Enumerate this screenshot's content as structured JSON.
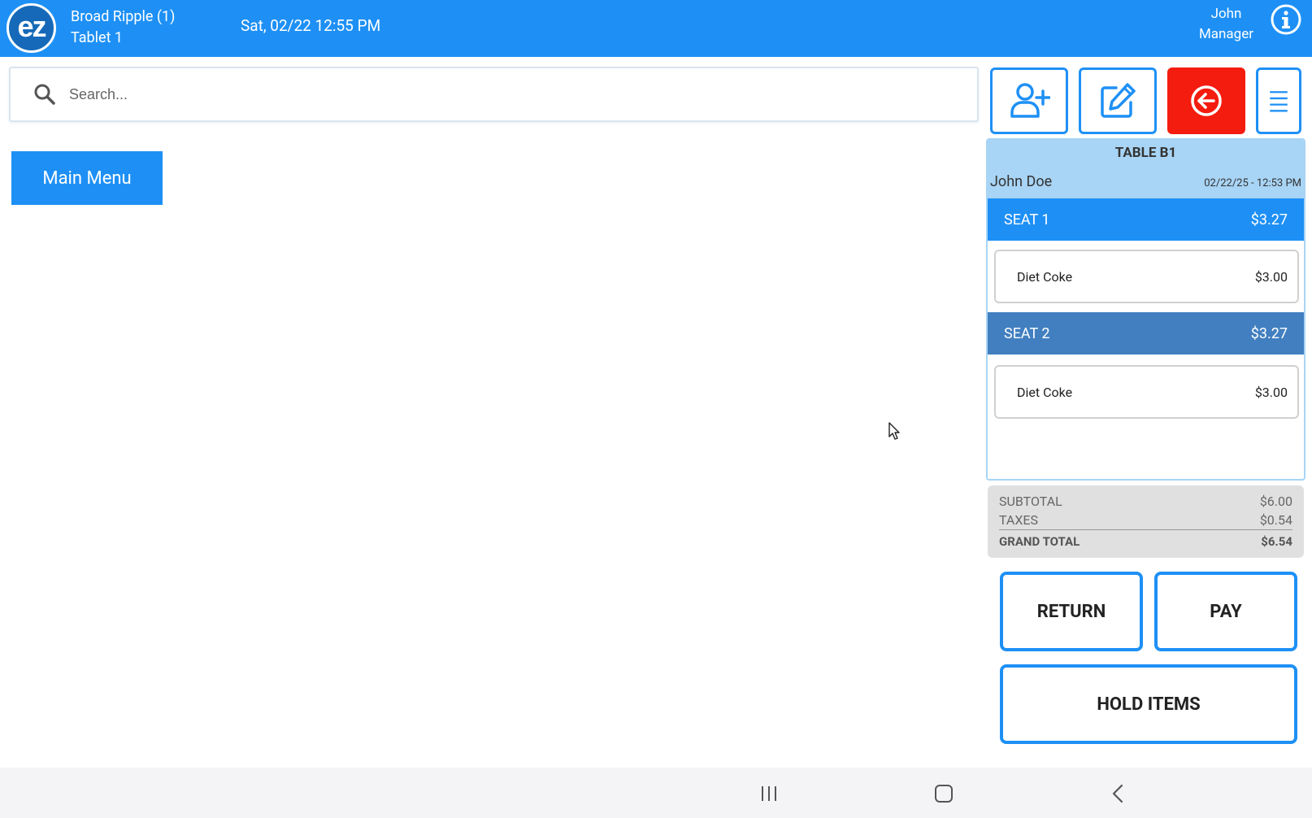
{
  "header": {
    "store_name": "Broad Ripple (1)",
    "device": "Tablet 1",
    "datetime": "Sat, 02/22 12:55 PM",
    "user_name": "John",
    "user_role": "Manager",
    "logo_text": "ez",
    "info_icon": "info-circle-icon",
    "bg_color": "#1e90f5"
  },
  "search": {
    "placeholder": "Search...",
    "value": "",
    "icon": "search-icon"
  },
  "main_menu": {
    "label": "Main Menu"
  },
  "toolbar": {
    "add_customer_icon": "user-plus-icon",
    "edit_icon": "edit-icon",
    "back_icon": "circle-arrow-left-icon",
    "menu_icon": "hamburger-menu-icon",
    "back_color": "#f41c0f"
  },
  "order": {
    "table": "TABLE B1",
    "customer": "John Doe",
    "timestamp": "02/22/25  - 12:53 PM",
    "seats": [
      {
        "label": "SEAT 1",
        "total": "$3.27",
        "items": [
          {
            "name": "Diet Coke",
            "price": "$3.00"
          }
        ]
      },
      {
        "label": "SEAT 2",
        "total": "$3.27",
        "items": [
          {
            "name": "Diet Coke",
            "price": "$3.00"
          }
        ]
      }
    ]
  },
  "totals": {
    "subtotal_label": "SUBTOTAL",
    "subtotal": "$6.00",
    "taxes_label": "TAXES",
    "taxes": "$0.54",
    "grand_total_label": "GRAND TOTAL",
    "grand_total": "$6.54"
  },
  "actions": {
    "return_label": "RETURN",
    "pay_label": "PAY",
    "hold_label": "HOLD ITEMS"
  },
  "system_nav": {
    "recent_icon": "recent-apps-icon",
    "home_icon": "home-icon",
    "back_icon": "back-chevron-icon"
  }
}
